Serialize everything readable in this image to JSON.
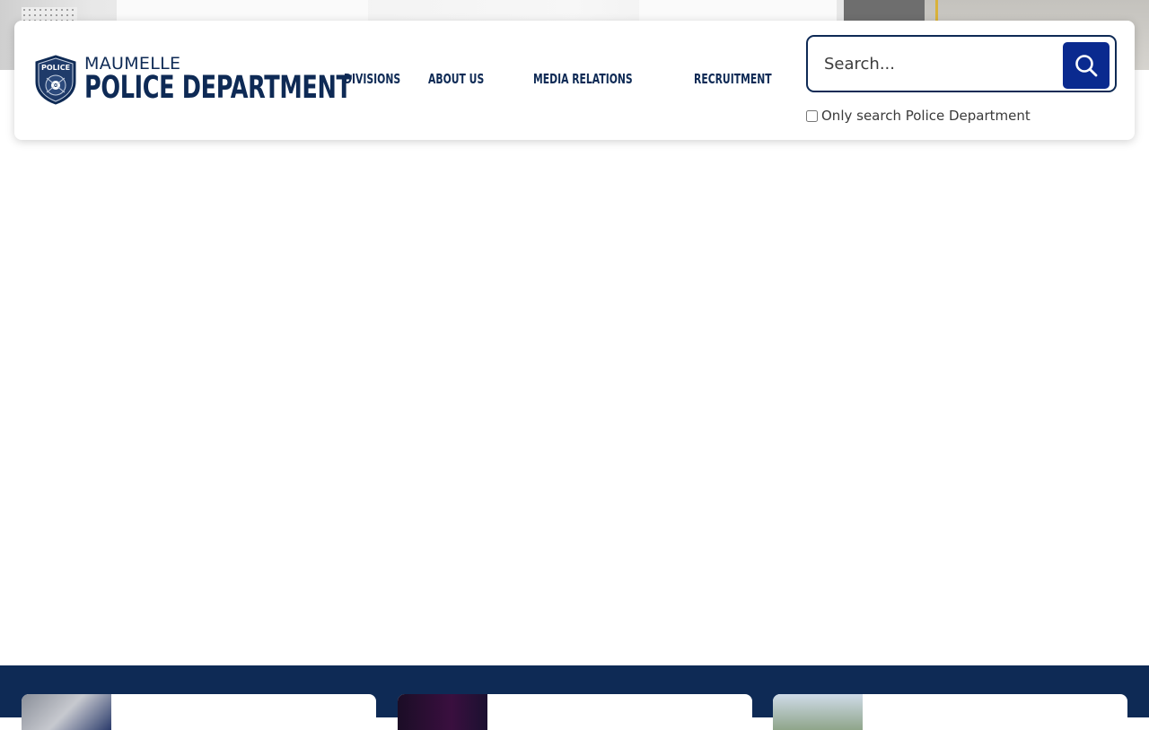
{
  "brand": {
    "top_line": "MAUMELLE",
    "bottom_line": "POLICE DEPARTMENT",
    "badge_icon": "police-badge-icon"
  },
  "nav": {
    "items": [
      {
        "label": "DIVISIONS"
      },
      {
        "label": "ABOUT US"
      },
      {
        "label": "MEDIA RELATIONS"
      },
      {
        "label": "RECRUITMENT"
      }
    ]
  },
  "search": {
    "placeholder": "Search...",
    "button_icon": "search-icon",
    "only_search_label": "Only search Police Department",
    "only_search_checked": false
  },
  "colors": {
    "brand_navy": "#0e2a55",
    "search_button": "#0a2a8f",
    "footer_band": "#0e2a55"
  }
}
